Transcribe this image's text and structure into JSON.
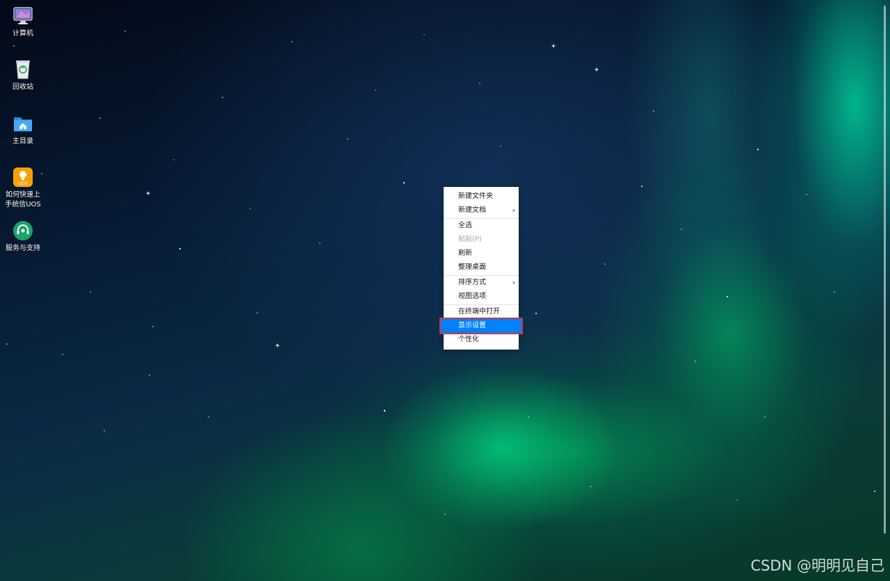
{
  "desktop_icons": [
    {
      "id": "computer",
      "label": "计算机",
      "icon": "computer-icon"
    },
    {
      "id": "trash",
      "label": "回收站",
      "icon": "trash-icon"
    },
    {
      "id": "home",
      "label": "主目录",
      "icon": "home-folder-icon"
    },
    {
      "id": "guide",
      "label": "如何快速上\n手统信UOS",
      "icon": "lightbulb-icon"
    },
    {
      "id": "support",
      "label": "服务与支持",
      "icon": "headset-icon"
    }
  ],
  "context_menu": {
    "items": [
      {
        "label": "新建文件夹"
      },
      {
        "label": "新建文档",
        "submenu": true,
        "arrow": "›"
      },
      {
        "label": "全选"
      },
      {
        "label": "粘贴(P)",
        "disabled": true
      },
      {
        "label": "刷新"
      },
      {
        "label": "整理桌面"
      },
      {
        "label": "排序方式",
        "submenu": true,
        "arrow": "›"
      },
      {
        "label": "视图选项"
      },
      {
        "label": "在终端中打开"
      },
      {
        "label": "显示设置",
        "highlighted": true
      },
      {
        "label": "个性化"
      }
    ],
    "highlight_color": "#0081ff",
    "annotation_border_color": "#d6362f"
  },
  "watermark": "CSDN @明明见自己"
}
